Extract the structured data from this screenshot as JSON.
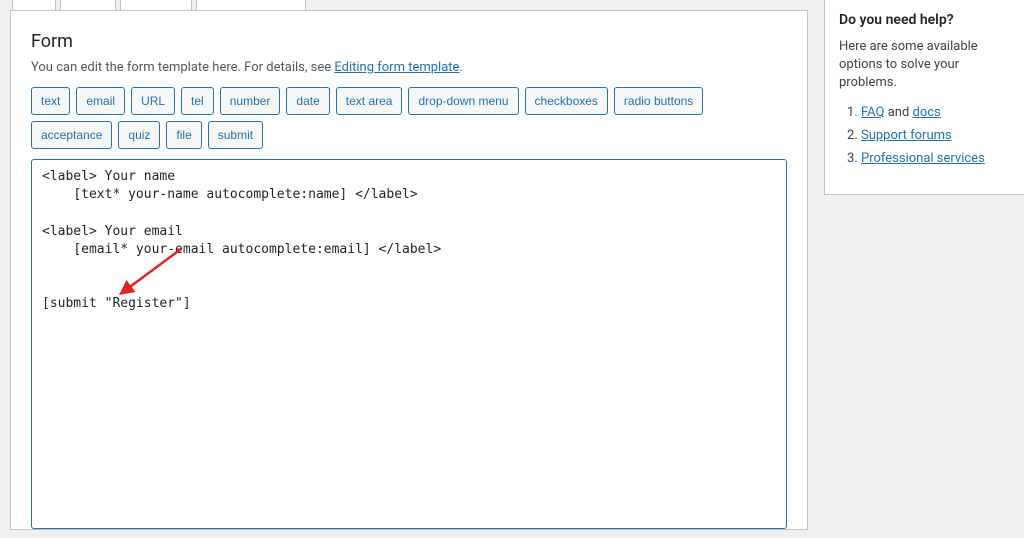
{
  "panel": {
    "title": "Form",
    "helper_pre": "You can edit the form template here. For details, see ",
    "helper_link": "Editing form template",
    "helper_post": ".",
    "tags": [
      "text",
      "email",
      "URL",
      "tel",
      "number",
      "date",
      "text area",
      "drop-down menu",
      "checkboxes",
      "radio buttons",
      "acceptance",
      "quiz",
      "file",
      "submit"
    ],
    "editor_value": "<label> Your name\n    [text* your-name autocomplete:name] </label>\n\n<label> Your email\n    [email* your-email autocomplete:email] </label>\n\n\n[submit \"Register\"]"
  },
  "sidebar": {
    "title": "Do you need help?",
    "text": "Here are some available options to solve your problems.",
    "items": [
      {
        "pre": "",
        "link": "FAQ",
        "mid": " and ",
        "link2": "docs"
      },
      {
        "pre": "",
        "link": "Support forums",
        "mid": "",
        "link2": ""
      },
      {
        "pre": "",
        "link": "Professional services",
        "mid": "",
        "link2": ""
      }
    ]
  }
}
